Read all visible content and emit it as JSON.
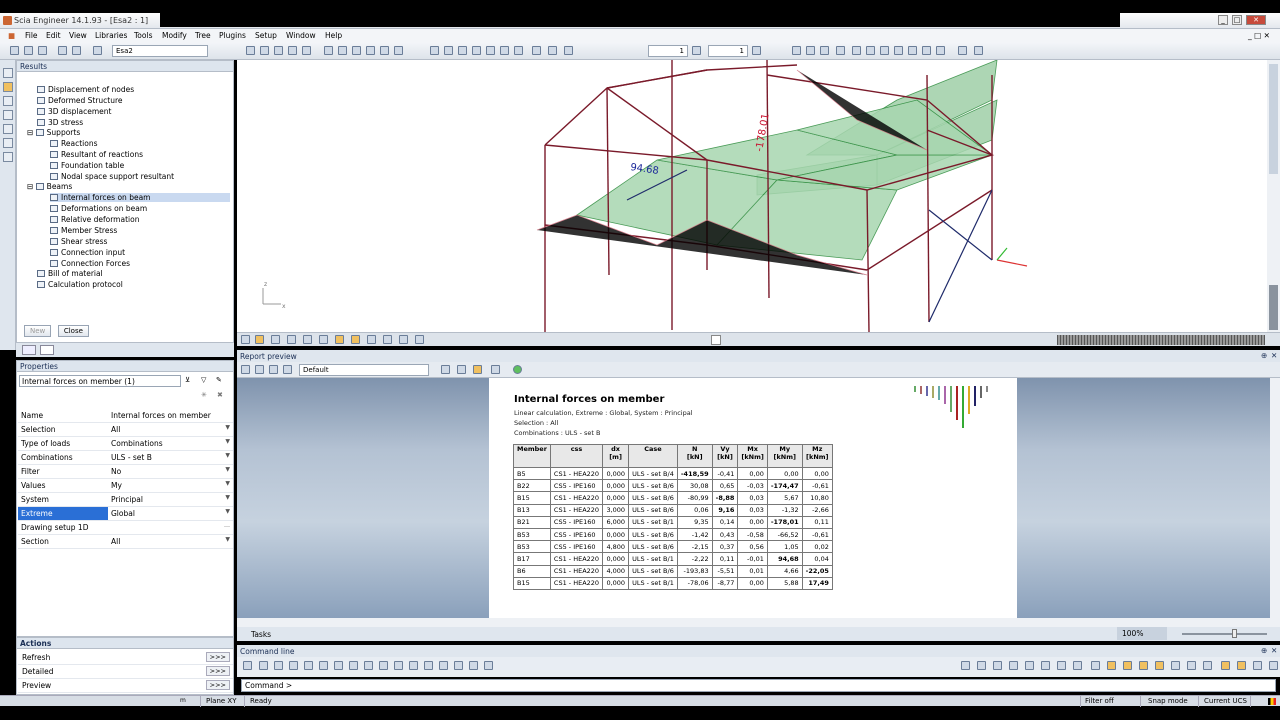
{
  "window": {
    "title": "Scia Engineer 14.1.93 - [Esa2 : 1]"
  },
  "menu": [
    "File",
    "Edit",
    "View",
    "Tools",
    "Modify",
    "Libraries",
    "Tree",
    "Plugins",
    "Setup",
    "Window",
    "Help"
  ],
  "toolbar": {
    "project_combo": "Esa2",
    "spin1": "1",
    "spin2": "1"
  },
  "results_panel": {
    "title": "Results",
    "items": [
      "Displacement of nodes",
      "Deformed Structure",
      "3D displacement",
      "3D stress",
      "Supports",
      "Reactions",
      "Resultant of reactions",
      "Foundation table",
      "Nodal space support resultant",
      "Beams",
      "Internal forces on beam",
      "Deformations on beam",
      "Relative deformation",
      "Member Stress",
      "Shear stress",
      "Connection input",
      "Connection Forces",
      "Bill of material",
      "Calculation protocol"
    ],
    "new_button": "New",
    "close_button": "Close"
  },
  "viewport": {
    "label1": "94.68",
    "label2": "-178.01",
    "axis_x": "x",
    "axis_z": "z"
  },
  "properties": {
    "title": "Properties",
    "combo": "Internal forces on member (1)",
    "rows": [
      {
        "key": "Name",
        "value": "Internal forces on member"
      },
      {
        "key": "Selection",
        "value": "All"
      },
      {
        "key": "Type of loads",
        "value": "Combinations"
      },
      {
        "key": "Combinations",
        "value": "ULS - set B"
      },
      {
        "key": "Filter",
        "value": "No"
      },
      {
        "key": "Values",
        "value": "My"
      },
      {
        "key": "System",
        "value": "Principal"
      },
      {
        "key": "Extreme",
        "value": "Global"
      },
      {
        "key": "Drawing setup 1D",
        "value": ""
      },
      {
        "key": "Section",
        "value": "All"
      }
    ]
  },
  "actions": {
    "title": "Actions",
    "items": [
      "Refresh",
      "Detailed",
      "Preview"
    ],
    "go": ">>>"
  },
  "report": {
    "panel_title": "Report preview",
    "template_combo": "Default",
    "title": "Internal forces on member",
    "sub1": "Linear calculation, Extreme : Global, System : Principal",
    "sub2": "Selection : All",
    "sub3": "Combinations : ULS - set B",
    "headers": [
      [
        "Member"
      ],
      [
        "css"
      ],
      [
        "dx",
        "[m]"
      ],
      [
        "Case"
      ],
      [
        "N",
        "[kN]"
      ],
      [
        "Vy",
        "[kN]"
      ],
      [
        "Mx",
        "[kNm]"
      ],
      [
        "My",
        "[kNm]"
      ],
      [
        "Mz",
        "[kNm]"
      ]
    ],
    "rows": [
      [
        "B5",
        "CS1 - HEA220",
        "0,000",
        "ULS - set B/4",
        "-418,59",
        "-0,41",
        "0,00",
        "0,00",
        "0,00"
      ],
      [
        "B22",
        "CS5 - IPE160",
        "0,000",
        "ULS - set B/6",
        "30,08",
        "0,65",
        "-0,03",
        "-174,47",
        "-0,61"
      ],
      [
        "B15",
        "CS1 - HEA220",
        "0,000",
        "ULS - set B/6",
        "-80,99",
        "-8,88",
        "0,03",
        "5,67",
        "10,80"
      ],
      [
        "B13",
        "CS1 - HEA220",
        "3,000",
        "ULS - set B/6",
        "0,06",
        "9,16",
        "0,03",
        "-1,32",
        "-2,66"
      ],
      [
        "B21",
        "CS5 - IPE160",
        "6,000",
        "ULS - set B/1",
        "9,35",
        "0,14",
        "0,00",
        "-178,01",
        "0,11"
      ],
      [
        "B53",
        "CS5 - IPE160",
        "0,000",
        "ULS - set B/6",
        "-1,42",
        "0,43",
        "-0,58",
        "-66,52",
        "-0,61"
      ],
      [
        "B53",
        "CS5 - IPE160",
        "4,800",
        "ULS - set B/6",
        "-2,15",
        "0,37",
        "0,56",
        "1,05",
        "0,02"
      ],
      [
        "B17",
        "CS1 - HEA220",
        "0,000",
        "ULS - set B/1",
        "-2,22",
        "0,11",
        "-0,01",
        "94,68",
        "0,04"
      ],
      [
        "B6",
        "CS1 - HEA220",
        "4,000",
        "ULS - set B/6",
        "-193,83",
        "-5,51",
        "0,01",
        "4,66",
        "-22,05"
      ],
      [
        "B15",
        "CS1 - HEA220",
        "0,000",
        "ULS - set B/1",
        "-78,06",
        "-8,77",
        "0,00",
        "5,88",
        "17,49"
      ]
    ],
    "bold": [
      [
        0,
        4
      ],
      [
        1,
        7
      ],
      [
        2,
        5
      ],
      [
        3,
        5
      ],
      [
        4,
        7
      ],
      [
        7,
        7
      ],
      [
        8,
        8
      ],
      [
        9,
        8
      ]
    ]
  },
  "tasks": {
    "label": "Tasks",
    "zoom": "100%"
  },
  "command": {
    "panel_title": "Command line",
    "prompt": "Command >"
  },
  "status": {
    "plane": "Plane XY",
    "ready": "Ready",
    "filter": "Filter off",
    "snap": "Snap mode",
    "ucs": "Current UCS"
  },
  "colors": {
    "accent": "#1b2f55",
    "selected": "#2a6fd6",
    "beam": "#7a1a2a",
    "slab": "#8fc89a"
  }
}
